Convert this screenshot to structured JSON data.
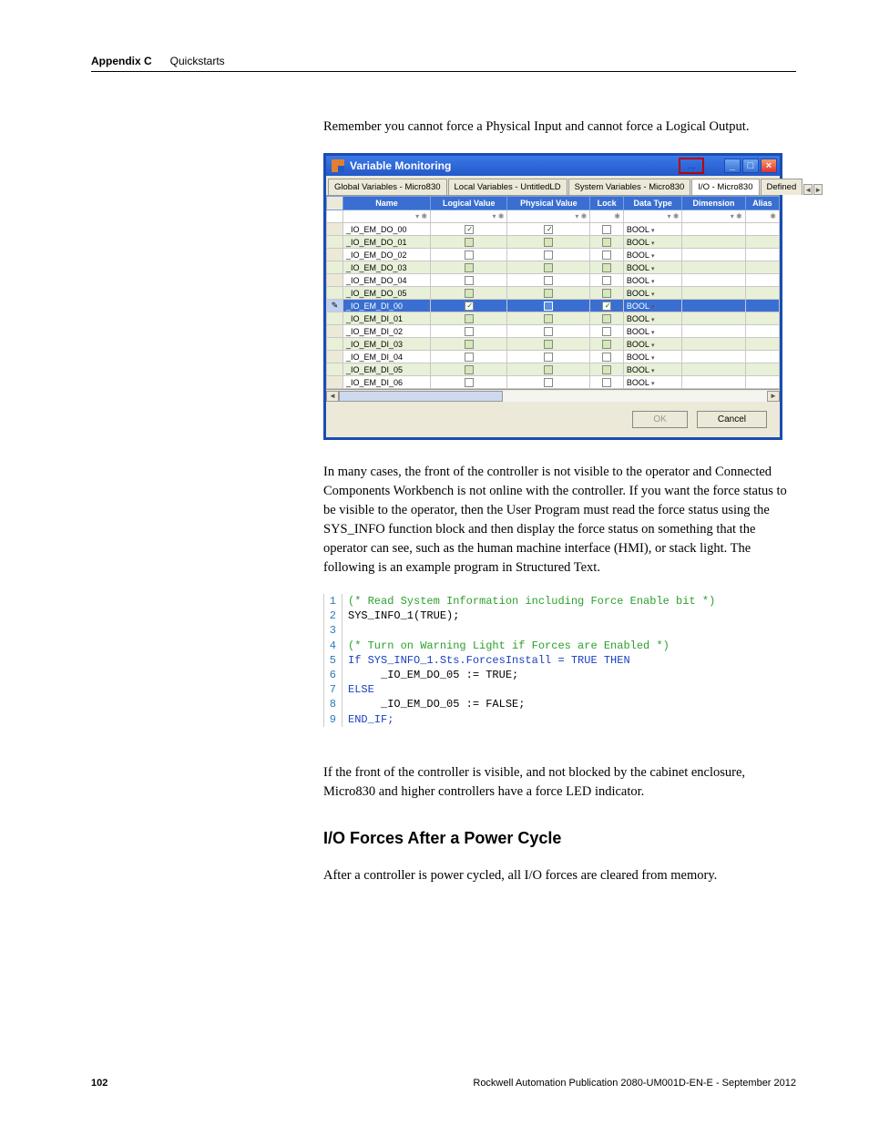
{
  "header": {
    "appendix": "Appendix C",
    "section": "Quickstarts"
  },
  "para1": "Remember you cannot force a Physical Input and cannot force a Logical Output.",
  "window": {
    "title": "Variable Monitoring",
    "tabs": [
      "Global Variables - Micro830",
      "Local Variables - UntitledLD",
      "System Variables - Micro830",
      "I/O - Micro830",
      "Defined"
    ],
    "columns": [
      "Name",
      "Logical Value",
      "Physical Value",
      "Lock",
      "Data Type",
      "Dimension",
      "Alias"
    ],
    "rows": [
      {
        "name": "_IO_EM_DO_00",
        "lv": "v",
        "pv": "v",
        "lock": "",
        "dt": "BOOL"
      },
      {
        "name": "_IO_EM_DO_01",
        "lv": "",
        "pv": "",
        "lock": "",
        "dt": "BOOL"
      },
      {
        "name": "_IO_EM_DO_02",
        "lv": "",
        "pv": "",
        "lock": "",
        "dt": "BOOL"
      },
      {
        "name": "_IO_EM_DO_03",
        "lv": "",
        "pv": "",
        "lock": "",
        "dt": "BOOL"
      },
      {
        "name": "_IO_EM_DO_04",
        "lv": "",
        "pv": "",
        "lock": "",
        "dt": "BOOL"
      },
      {
        "name": "_IO_EM_DO_05",
        "lv": "",
        "pv": "",
        "lock": "",
        "dt": "BOOL"
      },
      {
        "name": "_IO_EM_DI_00",
        "lv": "v",
        "pv": "s",
        "lock": "v",
        "dt": "BOOL",
        "sel": true
      },
      {
        "name": "_IO_EM_DI_01",
        "lv": "",
        "pv": "",
        "lock": "",
        "dt": "BOOL"
      },
      {
        "name": "_IO_EM_DI_02",
        "lv": "",
        "pv": "",
        "lock": "",
        "dt": "BOOL"
      },
      {
        "name": "_IO_EM_DI_03",
        "lv": "",
        "pv": "",
        "lock": "",
        "dt": "BOOL"
      },
      {
        "name": "_IO_EM_DI_04",
        "lv": "",
        "pv": "",
        "lock": "",
        "dt": "BOOL"
      },
      {
        "name": "_IO_EM_DI_05",
        "lv": "",
        "pv": "",
        "lock": "",
        "dt": "BOOL"
      },
      {
        "name": "_IO_EM_DI_06",
        "lv": "",
        "pv": "",
        "lock": "",
        "dt": "BOOL"
      }
    ],
    "ok": "OK",
    "cancel": "Cancel"
  },
  "para2": "In many cases, the front of the controller is not visible to the operator and Connected Components Workbench is not online with the controller.  If you want the force status to be visible to the operator, then the User Program must read the force status using the SYS_INFO function block and then display the force status on something that the operator can see, such as the human machine interface (HMI), or stack light. The following is an example program in Structured Text.",
  "code": [
    {
      "n": 1,
      "t": "(* Read System Information including Force Enable bit *)",
      "cls": "c-comment"
    },
    {
      "n": 2,
      "t": "SYS_INFO_1(TRUE);",
      "cls": "c-def"
    },
    {
      "n": 3,
      "t": "",
      "cls": "c-def"
    },
    {
      "n": 4,
      "t": "(* Turn on Warning Light if Forces are Enabled *)",
      "cls": "c-comment"
    },
    {
      "n": 5,
      "t": "If SYS_INFO_1.Sts.ForcesInstall = TRUE THEN",
      "cls": "c-kw"
    },
    {
      "n": 6,
      "t": "     _IO_EM_DO_05 := TRUE;",
      "cls": "c-def"
    },
    {
      "n": 7,
      "t": "ELSE",
      "cls": "c-kw"
    },
    {
      "n": 8,
      "t": "     _IO_EM_DO_05 := FALSE;",
      "cls": "c-def"
    },
    {
      "n": 9,
      "t": "END_IF;",
      "cls": "c-kw"
    }
  ],
  "para3": "If the front of the controller is visible, and not blocked by the cabinet enclosure, Micro830 and higher controllers have a force LED indicator.",
  "h2": "I/O Forces After a Power Cycle",
  "para4": "After a controller is power cycled, all I/O forces are cleared from memory.",
  "footer": {
    "page": "102",
    "pub": "Rockwell Automation Publication 2080-UM001D-EN-E - September 2012"
  }
}
